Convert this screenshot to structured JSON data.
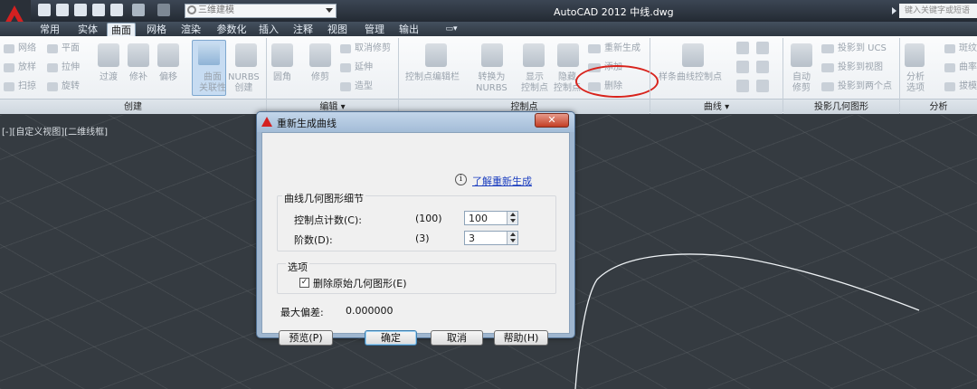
{
  "title_bar": {
    "window_title": "AutoCAD 2012    中线.dwg",
    "workspace": "三维建模",
    "search_placeholder": "键入关键字或短语",
    "qat_icons": [
      "new-icon",
      "open-icon",
      "save-icon",
      "save-as-icon",
      "print-icon",
      "undo-icon",
      "redo-icon"
    ]
  },
  "tabs": [
    "常用",
    "实体",
    "曲面",
    "网格",
    "渲染",
    "参数化",
    "插入",
    "注释",
    "视图",
    "管理",
    "输出"
  ],
  "active_tab": "曲面",
  "ribbon": {
    "create": {
      "small_left": [
        "网络",
        "放样",
        "扫掠"
      ],
      "small_right": [
        "平面",
        "拉伸",
        "旋转"
      ],
      "big": [
        "过渡",
        "修补",
        "偏移",
        "曲面\n关联性",
        "NURBS\n创建"
      ],
      "footer": "创建"
    },
    "edit": {
      "big": [
        "圆角",
        "修剪"
      ],
      "small": [
        "取消修剪",
        "延伸",
        "造型"
      ],
      "footer": "编辑 ▾"
    },
    "control_points": {
      "big": [
        "控制点编辑栏",
        "转换为\nNURBS",
        "显示\n控制点",
        "隐藏\n控制点"
      ],
      "small": [
        "重新生成",
        "添加",
        "删除"
      ],
      "footer": "控制点"
    },
    "curves": {
      "big": [
        "样条曲线控制点"
      ],
      "footer": "曲线 ▾"
    },
    "projection": {
      "big": [
        "自动\n修剪"
      ],
      "small": [
        "投影到 UCS",
        "投影到视图",
        "投影到两个点"
      ],
      "footer": "投影几何图形"
    },
    "analysis": {
      "big": [
        "分析\n选项"
      ],
      "small": [
        "斑纹",
        "曲率",
        "拔模"
      ],
      "footer": "分析"
    }
  },
  "viewport": {
    "label": "[-][自定义视图][二维线框]"
  },
  "dialog": {
    "title": "重新生成曲线",
    "close": "✕",
    "learn_link": "了解重新生成",
    "group1": "曲线几何图形细节",
    "cp_label": "控制点计数(C):",
    "cp_hint": "(100)",
    "cp_value": "100",
    "deg_label": "阶数(D):",
    "deg_hint": "(3)",
    "deg_value": "3",
    "group2": "选项",
    "delete_label": "删除原始几何图形(E)",
    "delete_checked": true,
    "max_dev_label": "最大偏差:",
    "max_dev_value": "0.000000",
    "buttons": {
      "preview": "预览(P)",
      "ok": "确定",
      "cancel": "取消",
      "help": "帮助(H)"
    }
  },
  "colors": {
    "accent_red": "#d42020",
    "annotation_red": "#d8231c",
    "viewport_bg": "#353b41"
  }
}
